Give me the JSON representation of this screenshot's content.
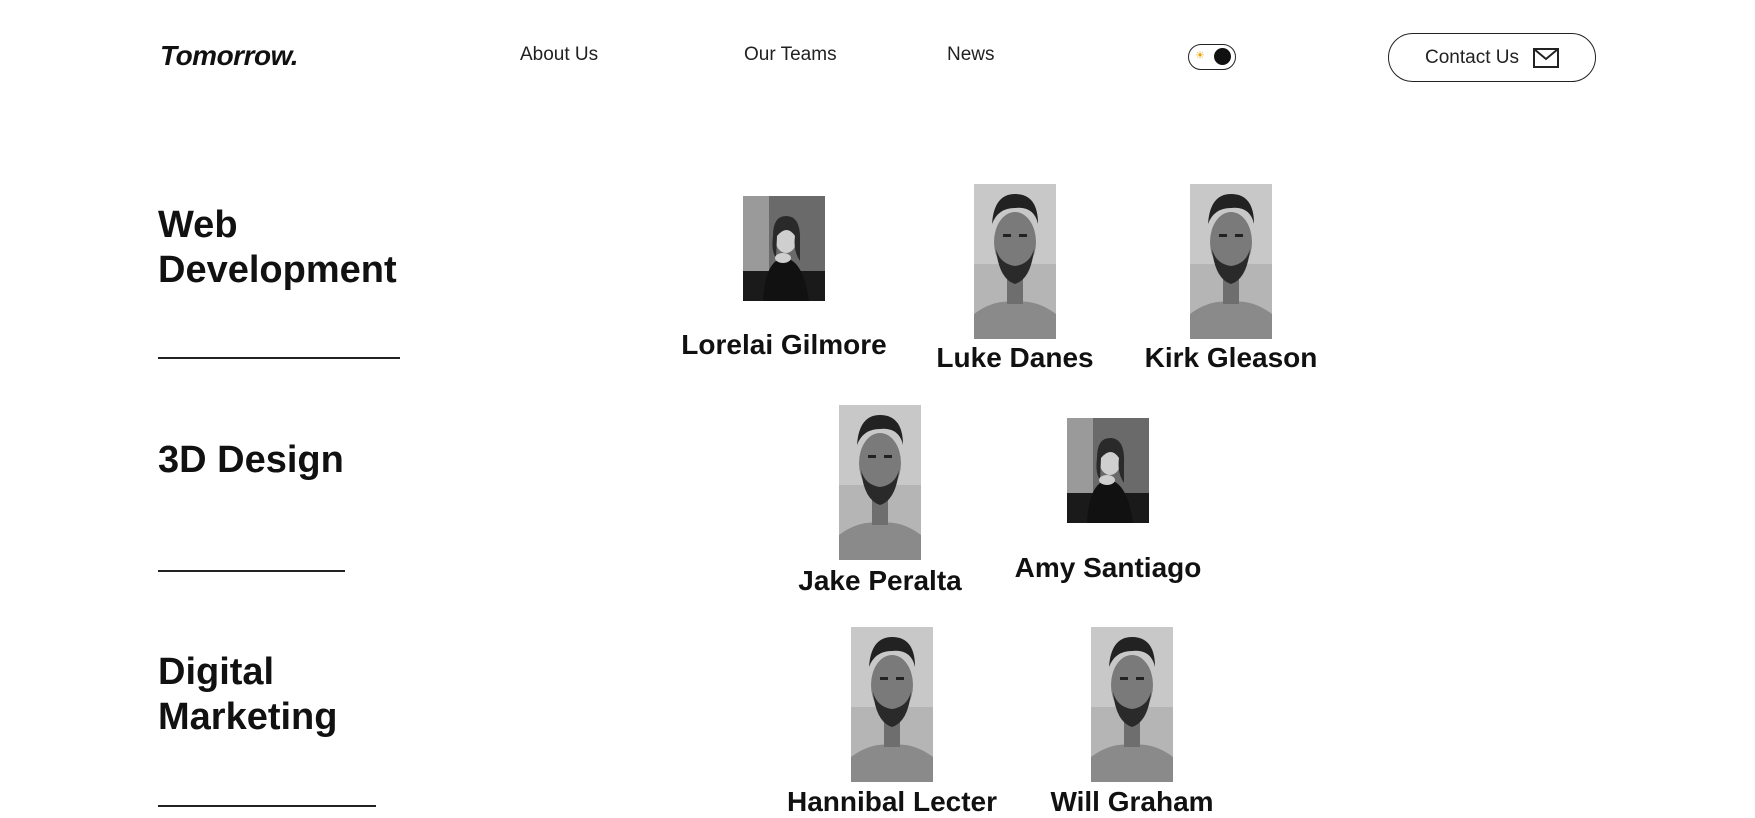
{
  "header": {
    "logo": "Tomorrow.",
    "nav": [
      {
        "label": "About Us"
      },
      {
        "label": "Our Teams"
      },
      {
        "label": "News"
      }
    ],
    "theme_toggle": {
      "state": "dark",
      "sun_icon": "sun-icon"
    },
    "contact": {
      "label": "Contact Us",
      "icon": "mail-icon"
    }
  },
  "sections": [
    {
      "title_line1": "Web",
      "title_line2": "Development",
      "members": [
        {
          "name": "Lorelai Gilmore",
          "photo": "woman-portrait"
        },
        {
          "name": "Luke Danes",
          "photo": "man-portrait"
        },
        {
          "name": "Kirk Gleason",
          "photo": "man-portrait"
        }
      ]
    },
    {
      "title_line1": "3D Design",
      "title_line2": "",
      "members": [
        {
          "name": "Jake Peralta",
          "photo": "man-portrait"
        },
        {
          "name": "Amy Santiago",
          "photo": "woman-portrait"
        }
      ]
    },
    {
      "title_line1": "Digital",
      "title_line2": "Marketing",
      "members": [
        {
          "name": "Hannibal Lecter",
          "photo": "man-portrait"
        },
        {
          "name": "Will Graham",
          "photo": "man-portrait"
        }
      ]
    }
  ]
}
